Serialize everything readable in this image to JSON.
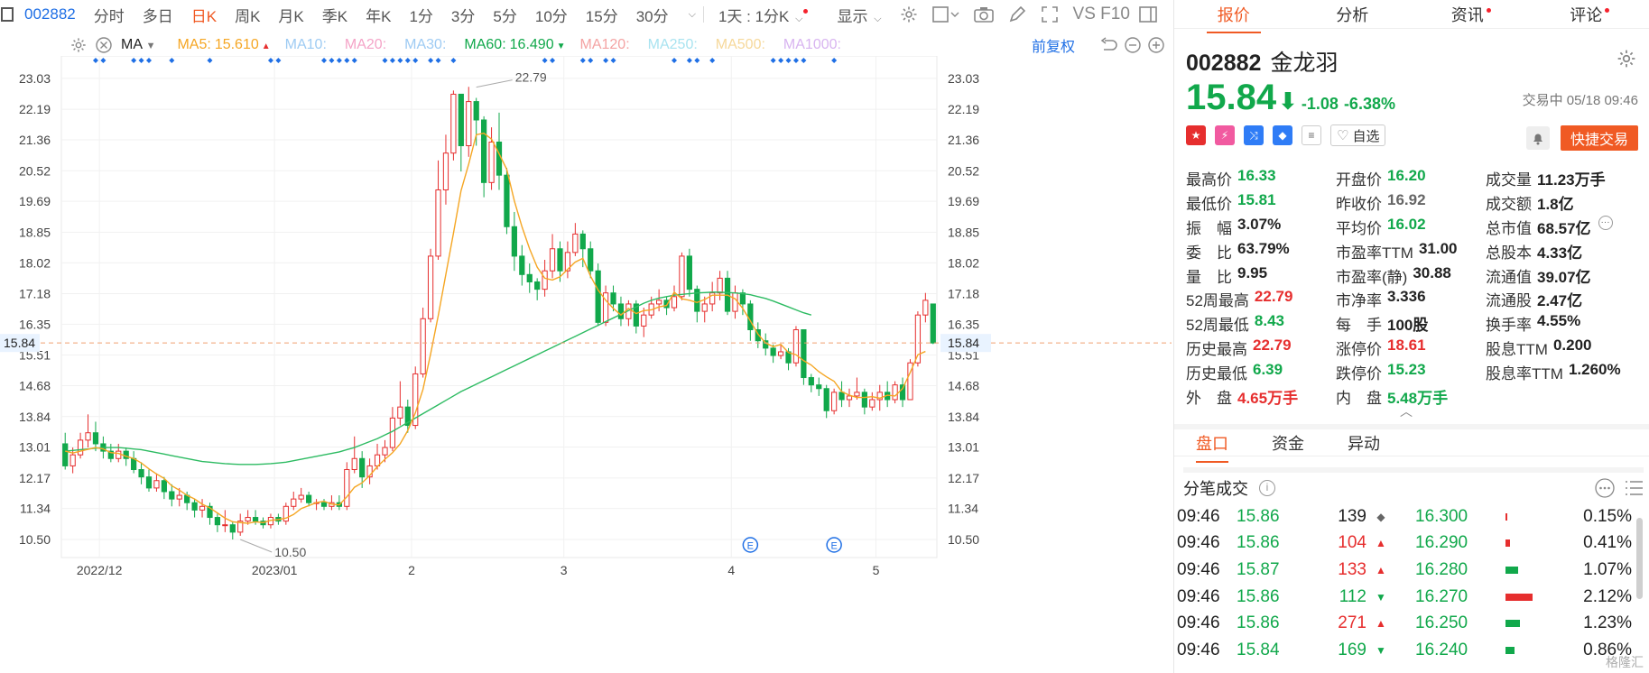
{
  "toolbar": {
    "code": "002882",
    "items": [
      {
        "label": "分时",
        "active": false
      },
      {
        "label": "多日",
        "active": false
      },
      {
        "label": "日K",
        "active": true
      },
      {
        "label": "周K",
        "active": false
      },
      {
        "label": "月K",
        "active": false
      },
      {
        "label": "季K",
        "active": false
      },
      {
        "label": "年K",
        "active": false
      },
      {
        "label": "1分",
        "active": false
      },
      {
        "label": "3分",
        "active": false
      },
      {
        "label": "5分",
        "active": false
      },
      {
        "label": "10分",
        "active": false
      },
      {
        "label": "15分",
        "active": false
      },
      {
        "label": "30分",
        "active": false
      }
    ],
    "period_select": "1天 : 1分K",
    "display_label": "显示",
    "f10_label": "VS F10"
  },
  "ma_line": {
    "indicator": "MA",
    "entries": [
      {
        "label": "MA5:",
        "value": "15.610",
        "color": "#f5a623",
        "dir": "up"
      },
      {
        "label": "MA10:",
        "value": "",
        "color": "#9ecbf3"
      },
      {
        "label": "MA20:",
        "value": "",
        "color": "#f4a3c7"
      },
      {
        "label": "MA30:",
        "value": "",
        "color": "#9ecbf3"
      },
      {
        "label": "MA60:",
        "value": "16.490",
        "color": "#11a84b",
        "dir": "down"
      },
      {
        "label": "MA120:",
        "value": "",
        "color": "#f4a3a3"
      },
      {
        "label": "MA250:",
        "value": "",
        "color": "#a8e3f0"
      },
      {
        "label": "MA500:",
        "value": "",
        "color": "#f6d89a"
      },
      {
        "label": "MA1000:",
        "value": "",
        "color": "#d8b4f0"
      }
    ],
    "adjust_label": "前复权"
  },
  "chart_data": {
    "type": "candlestick",
    "y_ticks": [
      "23.03",
      "22.19",
      "21.36",
      "20.52",
      "19.69",
      "18.85",
      "18.02",
      "17.18",
      "16.35",
      "15.51",
      "14.68",
      "13.84",
      "13.01",
      "12.17",
      "11.34",
      "10.50"
    ],
    "ylim": [
      10.01,
      23.64
    ],
    "x_labels": [
      {
        "label": "2022/12",
        "index": 5
      },
      {
        "label": "2023/01",
        "index": 28
      },
      {
        "label": "2",
        "index": 46
      },
      {
        "label": "3",
        "index": 66
      },
      {
        "label": "4",
        "index": 88
      },
      {
        "label": "5",
        "index": 107
      }
    ],
    "current_price_label": "15.84",
    "current_price": 15.84,
    "max_label": "22.79",
    "max_index": 54,
    "max_value": 22.79,
    "min_label": "10.50",
    "min_index": 23,
    "min_value": 10.5,
    "candles": [
      [
        13.1,
        12.5,
        13.4,
        12.4
      ],
      [
        12.5,
        12.8,
        13.0,
        12.3
      ],
      [
        12.8,
        13.2,
        13.4,
        12.7
      ],
      [
        13.2,
        13.4,
        13.9,
        13.0
      ],
      [
        13.4,
        13.1,
        13.7,
        12.9
      ],
      [
        13.1,
        12.9,
        13.3,
        12.7
      ],
      [
        12.9,
        12.7,
        13.1,
        12.6
      ],
      [
        12.7,
        12.9,
        13.1,
        12.6
      ],
      [
        12.9,
        12.7,
        13.0,
        12.5
      ],
      [
        12.7,
        12.4,
        12.9,
        12.3
      ],
      [
        12.4,
        12.2,
        12.6,
        12.0
      ],
      [
        12.2,
        11.9,
        12.4,
        11.8
      ],
      [
        11.9,
        12.1,
        12.3,
        11.8
      ],
      [
        12.1,
        11.8,
        12.2,
        11.6
      ],
      [
        11.8,
        11.6,
        12.0,
        11.4
      ],
      [
        11.6,
        11.7,
        11.9,
        11.4
      ],
      [
        11.7,
        11.5,
        11.8,
        11.3
      ],
      [
        11.5,
        11.3,
        11.6,
        11.1
      ],
      [
        11.3,
        11.4,
        11.6,
        11.1
      ],
      [
        11.4,
        11.1,
        11.5,
        10.9
      ],
      [
        11.1,
        10.9,
        11.2,
        10.7
      ],
      [
        10.9,
        10.9,
        11.3,
        10.7
      ],
      [
        10.9,
        10.7,
        11.0,
        10.5
      ],
      [
        10.7,
        11.0,
        11.2,
        10.6
      ],
      [
        11.0,
        11.1,
        11.3,
        10.9
      ],
      [
        11.1,
        11.0,
        11.3,
        10.9
      ],
      [
        11.0,
        10.9,
        11.1,
        10.8
      ],
      [
        10.9,
        11.1,
        11.2,
        10.8
      ],
      [
        11.1,
        11.0,
        11.2,
        10.9
      ],
      [
        11.0,
        11.4,
        11.5,
        10.9
      ],
      [
        11.4,
        11.6,
        11.8,
        11.3
      ],
      [
        11.6,
        11.7,
        11.9,
        11.5
      ],
      [
        11.7,
        11.5,
        11.8,
        11.4
      ],
      [
        11.5,
        11.5,
        11.6,
        11.3
      ],
      [
        11.5,
        11.4,
        11.6,
        11.3
      ],
      [
        11.4,
        11.5,
        11.7,
        11.3
      ],
      [
        11.5,
        11.4,
        11.7,
        11.3
      ],
      [
        11.4,
        12.4,
        12.6,
        11.3
      ],
      [
        12.4,
        12.7,
        13.3,
        12.3
      ],
      [
        12.7,
        12.2,
        12.9,
        11.9
      ],
      [
        12.2,
        12.5,
        12.7,
        12.0
      ],
      [
        12.5,
        12.8,
        13.1,
        12.4
      ],
      [
        12.8,
        13.0,
        13.2,
        12.6
      ],
      [
        13.0,
        13.8,
        14.1,
        12.9
      ],
      [
        13.8,
        14.1,
        14.8,
        13.6
      ],
      [
        14.1,
        13.6,
        14.3,
        13.4
      ],
      [
        13.6,
        15.0,
        15.2,
        13.5
      ],
      [
        15.0,
        16.5,
        16.8,
        14.9
      ],
      [
        16.5,
        18.2,
        18.4,
        16.4
      ],
      [
        18.2,
        20.0,
        20.8,
        18.1
      ],
      [
        20.0,
        21.0,
        21.5,
        19.6
      ],
      [
        21.0,
        22.6,
        22.7,
        20.8
      ],
      [
        22.6,
        21.2,
        22.6,
        20.5
      ],
      [
        21.2,
        22.4,
        22.8,
        20.9
      ],
      [
        22.4,
        21.9,
        22.5,
        21.2
      ],
      [
        21.9,
        20.2,
        22.0,
        19.8
      ],
      [
        20.2,
        21.3,
        21.7,
        20.0
      ],
      [
        21.3,
        20.4,
        22.1,
        20.0
      ],
      [
        20.4,
        19.0,
        20.6,
        18.8
      ],
      [
        19.0,
        18.2,
        19.4,
        17.8
      ],
      [
        18.2,
        17.7,
        18.5,
        17.4
      ],
      [
        17.7,
        17.5,
        18.0,
        17.2
      ],
      [
        17.5,
        17.3,
        17.6,
        17.0
      ],
      [
        17.3,
        17.8,
        18.1,
        17.1
      ],
      [
        17.8,
        18.4,
        18.8,
        17.6
      ],
      [
        18.4,
        17.8,
        18.6,
        17.5
      ],
      [
        17.8,
        18.3,
        18.6,
        17.6
      ],
      [
        18.3,
        18.8,
        19.1,
        18.2
      ],
      [
        18.8,
        18.4,
        18.9,
        17.9
      ],
      [
        18.4,
        17.8,
        18.6,
        17.6
      ],
      [
        17.8,
        16.4,
        18.0,
        16.3
      ],
      [
        16.4,
        17.2,
        17.4,
        16.3
      ],
      [
        17.2,
        16.9,
        17.4,
        16.7
      ],
      [
        16.9,
        16.5,
        17.1,
        16.3
      ],
      [
        16.5,
        16.9,
        17.0,
        16.3
      ],
      [
        16.9,
        16.3,
        17.0,
        16.1
      ],
      [
        16.3,
        16.6,
        16.8,
        16.0
      ],
      [
        16.6,
        16.9,
        17.1,
        16.5
      ],
      [
        16.9,
        17.0,
        17.3,
        16.7
      ],
      [
        17.0,
        16.8,
        17.1,
        16.6
      ],
      [
        16.8,
        17.1,
        17.4,
        16.7
      ],
      [
        17.1,
        18.2,
        18.3,
        17.0
      ],
      [
        18.2,
        17.3,
        18.4,
        17.1
      ],
      [
        17.3,
        16.7,
        17.4,
        16.4
      ],
      [
        16.7,
        16.9,
        17.1,
        16.4
      ],
      [
        16.9,
        17.2,
        17.5,
        16.7
      ],
      [
        17.2,
        17.6,
        17.8,
        17.0
      ],
      [
        17.6,
        16.7,
        17.8,
        16.6
      ],
      [
        16.7,
        17.2,
        17.4,
        16.5
      ],
      [
        17.2,
        16.9,
        17.3,
        16.6
      ],
      [
        16.9,
        16.2,
        17.0,
        15.9
      ],
      [
        16.2,
        15.9,
        16.4,
        15.7
      ],
      [
        15.9,
        15.7,
        16.1,
        15.5
      ],
      [
        15.7,
        15.5,
        15.8,
        15.3
      ],
      [
        15.5,
        15.6,
        15.8,
        15.4
      ],
      [
        15.6,
        15.3,
        15.7,
        15.1
      ],
      [
        15.3,
        16.2,
        16.3,
        15.2
      ],
      [
        16.2,
        14.9,
        16.2,
        14.7
      ],
      [
        14.9,
        14.7,
        15.0,
        14.5
      ],
      [
        14.7,
        14.6,
        14.9,
        14.4
      ],
      [
        14.6,
        14.0,
        14.7,
        13.8
      ],
      [
        14.0,
        14.5,
        14.6,
        13.9
      ],
      [
        14.5,
        14.3,
        14.8,
        14.1
      ],
      [
        14.3,
        14.4,
        14.6,
        14.1
      ],
      [
        14.4,
        14.5,
        14.9,
        14.3
      ],
      [
        14.5,
        14.1,
        14.6,
        13.9
      ],
      [
        14.1,
        14.3,
        14.5,
        14.0
      ],
      [
        14.3,
        14.5,
        14.7,
        14.0
      ],
      [
        14.5,
        14.3,
        14.8,
        14.1
      ],
      [
        14.3,
        14.7,
        14.8,
        14.2
      ],
      [
        14.7,
        14.3,
        14.9,
        14.1
      ],
      [
        14.3,
        15.3,
        15.4,
        14.3
      ],
      [
        15.3,
        16.6,
        16.7,
        15.2
      ],
      [
        16.6,
        17.0,
        17.2,
        16.4
      ],
      [
        16.9,
        15.84,
        16.33,
        15.81
      ]
    ],
    "ma5": [
      12.9,
      12.85,
      12.9,
      12.95,
      13.0,
      12.96,
      12.86,
      12.84,
      12.76,
      12.7,
      12.58,
      12.42,
      12.28,
      12.16,
      11.96,
      11.84,
      11.7,
      11.6,
      11.46,
      11.36,
      11.22,
      11.08,
      10.98,
      10.96,
      10.94,
      10.98,
      10.96,
      11.02,
      11.04,
      11.08,
      11.18,
      11.34,
      11.42,
      11.5,
      11.54,
      11.46,
      11.44,
      11.66,
      11.92,
      12.04,
      12.24,
      12.48,
      12.68,
      12.86,
      13.1,
      13.46,
      13.94,
      14.58,
      15.54,
      16.58,
      17.7,
      18.82,
      19.98,
      20.7,
      21.5,
      21.54,
      21.38,
      20.98,
      20.56,
      19.7,
      19.0,
      18.4,
      17.9,
      17.6,
      17.55,
      17.64,
      17.84,
      18.04,
      18.14,
      17.66,
      17.28,
      17.0,
      16.78,
      16.6,
      16.78,
      16.64,
      16.72,
      16.74,
      16.82,
      16.86,
      17.22,
      17.04,
      17.0,
      16.94,
      17.02,
      17.14,
      17.14,
      17.14,
      17.04,
      16.78,
      16.44,
      16.08,
      15.84,
      15.74,
      15.8,
      15.58,
      15.52,
      15.36,
      15.24,
      15.06,
      14.92,
      14.8,
      14.52,
      14.42,
      14.36,
      14.36,
      14.38,
      14.34,
      14.42,
      14.4,
      14.6,
      15.04,
      15.52,
      15.61
    ],
    "ma60": [
      12.9,
      12.92,
      12.94,
      12.96,
      12.98,
      13.0,
      13.0,
      13.0,
      12.98,
      12.96,
      12.94,
      12.9,
      12.86,
      12.82,
      12.78,
      12.74,
      12.7,
      12.66,
      12.62,
      12.6,
      12.58,
      12.56,
      12.55,
      12.54,
      12.54,
      12.54,
      12.55,
      12.56,
      12.58,
      12.6,
      12.64,
      12.68,
      12.72,
      12.76,
      12.8,
      12.84,
      12.88,
      12.94,
      13.0,
      13.08,
      13.16,
      13.24,
      13.34,
      13.44,
      13.56,
      13.68,
      13.8,
      13.92,
      14.04,
      14.16,
      14.28,
      14.4,
      14.52,
      14.62,
      14.72,
      14.82,
      14.92,
      15.02,
      15.12,
      15.22,
      15.32,
      15.42,
      15.52,
      15.62,
      15.72,
      15.82,
      15.92,
      16.02,
      16.12,
      16.22,
      16.32,
      16.42,
      16.52,
      16.62,
      16.72,
      16.82,
      16.92,
      17.0,
      17.06,
      17.1,
      17.14,
      17.16,
      17.18,
      17.2,
      17.21,
      17.22,
      17.22,
      17.21,
      17.2,
      17.18,
      17.15,
      17.1,
      17.05,
      16.98,
      16.9,
      16.82,
      16.74,
      16.66,
      16.6
    ]
  },
  "panel": {
    "tabs": [
      {
        "label": "报价",
        "active": true,
        "dot": false
      },
      {
        "label": "分析",
        "active": false,
        "dot": false
      },
      {
        "label": "资讯",
        "active": false,
        "dot": true
      },
      {
        "label": "评论",
        "active": false,
        "dot": true
      }
    ],
    "code": "002882",
    "name": "金龙羽",
    "price": "15.84",
    "change": "-1.08",
    "change_pct": "-6.38%",
    "status": "交易中 05/18 09:46",
    "watch_label": "自选",
    "quick_trade_label": "快捷交易",
    "quote_rows": [
      [
        {
          "label": "最高价",
          "value": "16.33",
          "color": "green"
        },
        {
          "label": "开盘价",
          "value": "16.20",
          "color": "green"
        },
        {
          "label": "成交量",
          "value": "11.23万手",
          "color": "black"
        }
      ],
      [
        {
          "label": "最低价",
          "value": "15.81",
          "color": "green"
        },
        {
          "label": "昨收价",
          "value": "16.92",
          "color": "grey"
        },
        {
          "label": "成交额",
          "value": "1.8亿",
          "color": "black"
        }
      ],
      [
        {
          "label": "振　幅",
          "value": "3.07%",
          "color": "black"
        },
        {
          "label": "平均价",
          "value": "16.02",
          "color": "green"
        },
        {
          "label": "总市值",
          "value": "68.57亿",
          "color": "black"
        }
      ],
      [
        {
          "label": "委　比",
          "value": "63.79%",
          "color": "black"
        },
        {
          "label": "市盈率TTM",
          "value": "31.00",
          "color": "black"
        },
        {
          "label": "总股本",
          "value": "4.33亿",
          "color": "black"
        }
      ],
      [
        {
          "label": "量　比",
          "value": "9.95",
          "color": "black"
        },
        {
          "label": "市盈率(静)",
          "value": "30.88",
          "color": "black"
        },
        {
          "label": "流通值",
          "value": "39.07亿",
          "color": "black"
        }
      ],
      [
        {
          "label": "52周最高",
          "value": "22.79",
          "color": "red"
        },
        {
          "label": "市净率",
          "value": "3.336",
          "color": "black"
        },
        {
          "label": "流通股",
          "value": "2.47亿",
          "color": "black"
        }
      ],
      [
        {
          "label": "52周最低",
          "value": "8.43",
          "color": "green"
        },
        {
          "label": "每　手",
          "value": "100股",
          "color": "black"
        },
        {
          "label": "换手率",
          "value": "4.55%",
          "color": "black"
        }
      ],
      [
        {
          "label": "历史最高",
          "value": "22.79",
          "color": "red"
        },
        {
          "label": "涨停价",
          "value": "18.61",
          "color": "red"
        },
        {
          "label": "股息TTM",
          "value": "0.200",
          "color": "black"
        }
      ],
      [
        {
          "label": "历史最低",
          "value": "6.39",
          "color": "green"
        },
        {
          "label": "跌停价",
          "value": "15.23",
          "color": "green"
        },
        {
          "label": "股息率TTM",
          "value": "1.260%",
          "color": "black"
        }
      ],
      [
        {
          "label": "外　盘",
          "value": "4.65万手",
          "color": "red"
        },
        {
          "label": "内　盘",
          "value": "5.48万手",
          "color": "green"
        },
        {
          "label": "",
          "value": "",
          "color": "black"
        }
      ]
    ],
    "sub_tabs": [
      {
        "label": "盘口",
        "active": true
      },
      {
        "label": "资金",
        "active": false
      },
      {
        "label": "异动",
        "active": false
      }
    ],
    "tick_title": "分笔成交",
    "ticks": [
      {
        "time": "09:46",
        "price": "15.86",
        "vol": "139",
        "dir": "flat",
        "level": "16.300",
        "bar": 0.02,
        "bar_color": "#e62e2e",
        "pct": "0.15%"
      },
      {
        "time": "09:46",
        "price": "15.86",
        "vol": "104",
        "dir": "up",
        "level": "16.290",
        "bar": 0.05,
        "bar_color": "#e62e2e",
        "pct": "0.41%"
      },
      {
        "time": "09:46",
        "price": "15.87",
        "vol": "133",
        "dir": "up",
        "level": "16.280",
        "bar": 0.14,
        "bar_color": "#11a84b",
        "pct": "1.07%"
      },
      {
        "time": "09:46",
        "price": "15.86",
        "vol": "112",
        "dir": "down",
        "level": "16.270",
        "bar": 0.3,
        "bar_color": "#e62e2e",
        "pct": "2.12%"
      },
      {
        "time": "09:46",
        "price": "15.86",
        "vol": "271",
        "dir": "up",
        "level": "16.250",
        "bar": 0.16,
        "bar_color": "#11a84b",
        "pct": "1.23%"
      },
      {
        "time": "09:46",
        "price": "15.84",
        "vol": "169",
        "dir": "down",
        "level": "16.240",
        "bar": 0.1,
        "bar_color": "#11a84b",
        "pct": "0.86%"
      }
    ],
    "watermark": "格隆汇"
  }
}
